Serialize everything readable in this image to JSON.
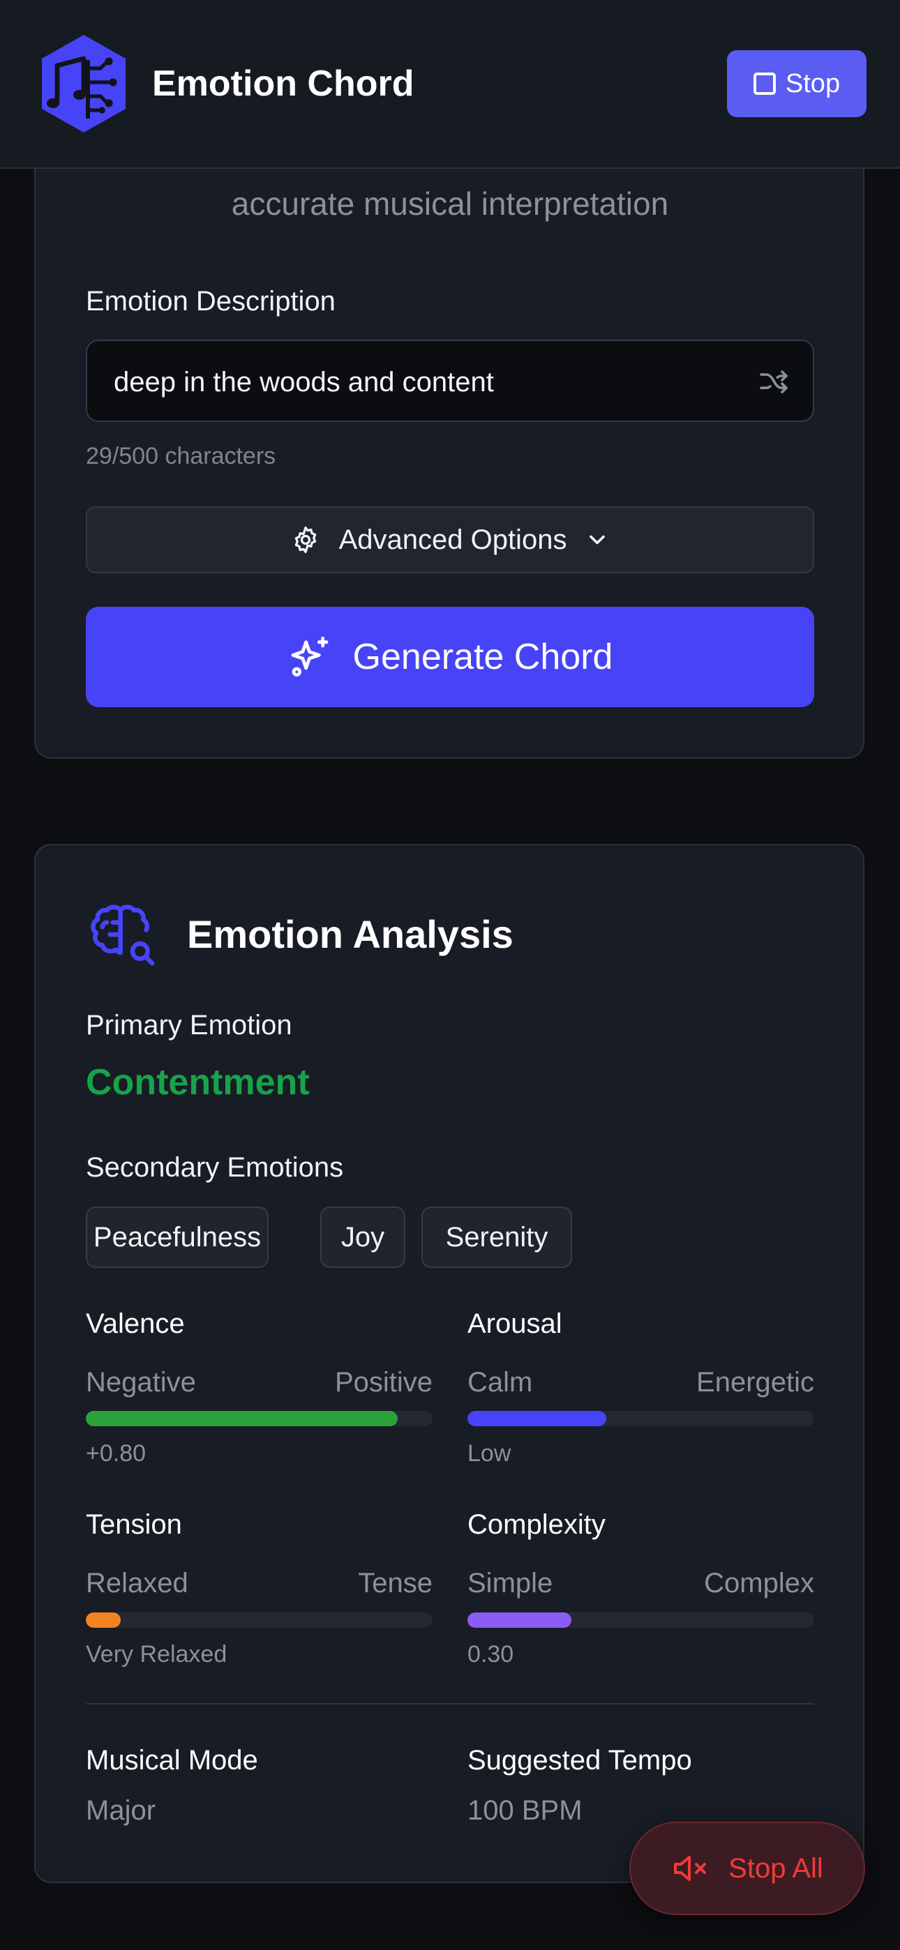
{
  "header": {
    "app_title": "Emotion Chord",
    "stop_label": "Stop"
  },
  "input_card": {
    "subtitle": "accurate musical interpretation",
    "emotion_label": "Emotion Description",
    "emotion_value": "deep in the woods and content",
    "char_count": "29/500 characters",
    "advanced_label": "Advanced Options",
    "generate_label": "Generate Chord"
  },
  "analysis": {
    "title": "Emotion Analysis",
    "primary_label": "Primary Emotion",
    "primary_value": "Contentment",
    "secondary_label": "Secondary Emotions",
    "secondary": [
      "Peacefulness",
      "Joy",
      "Serenity"
    ],
    "metrics": [
      {
        "name": "Valence",
        "low": "Negative",
        "high": "Positive",
        "value": "+0.80",
        "fill": 0.9,
        "color": "#2aa23a"
      },
      {
        "name": "Arousal",
        "low": "Calm",
        "high": "Energetic",
        "value": "Low",
        "fill": 0.4,
        "color": "#4744f7"
      },
      {
        "name": "Tension",
        "low": "Relaxed",
        "high": "Tense",
        "value": "Very Relaxed",
        "fill": 0.1,
        "color": "#f58220"
      },
      {
        "name": "Complexity",
        "low": "Simple",
        "high": "Complex",
        "value": "0.30",
        "fill": 0.3,
        "color": "#8b5cf6"
      }
    ],
    "mode_label": "Musical Mode",
    "mode_value": "Major",
    "tempo_label": "Suggested Tempo",
    "tempo_value": "100 BPM"
  },
  "stop_all_label": "Stop All",
  "colors": {
    "accent": "#4744f7",
    "positive": "#17a34a",
    "danger": "#ef3b3b"
  }
}
